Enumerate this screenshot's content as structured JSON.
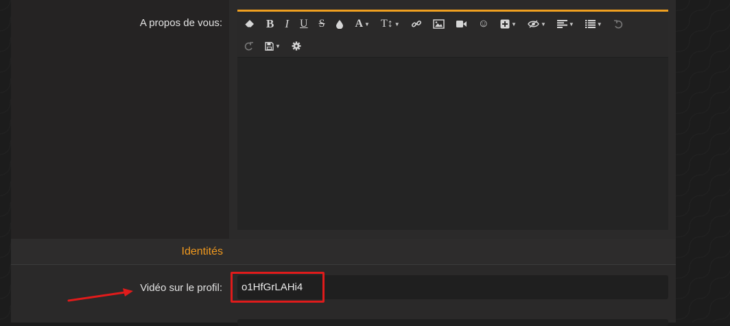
{
  "about": {
    "label": "A propos de vous:"
  },
  "toolbar": {
    "row1": [
      {
        "name": "eraser-icon",
        "label": ""
      },
      {
        "name": "bold-button",
        "label": "B"
      },
      {
        "name": "italic-button",
        "label": "I"
      },
      {
        "name": "underline-button",
        "label": "U"
      },
      {
        "name": "strikethrough-button",
        "label": "S"
      },
      {
        "name": "color-drop-icon",
        "label": ""
      },
      {
        "name": "font-family-button",
        "label": "A"
      },
      {
        "name": "font-size-button",
        "label": "T↕"
      },
      {
        "name": "link-icon",
        "label": ""
      },
      {
        "name": "image-icon",
        "label": ""
      },
      {
        "name": "video-icon",
        "label": ""
      },
      {
        "name": "smiley-icon",
        "label": "☺"
      },
      {
        "name": "insert-icon",
        "label": ""
      },
      {
        "name": "spoiler-icon",
        "label": ""
      },
      {
        "name": "align-icon",
        "label": ""
      },
      {
        "name": "list-icon",
        "label": ""
      },
      {
        "name": "undo-icon",
        "label": ""
      }
    ],
    "row2": [
      {
        "name": "redo-icon",
        "label": ""
      },
      {
        "name": "save-draft-icon",
        "label": ""
      },
      {
        "name": "settings-gear-icon",
        "label": ""
      }
    ]
  },
  "section": {
    "title": "Identités"
  },
  "video": {
    "label": "Vidéo sur le profil:",
    "value": "o1HfGrLAHi4"
  },
  "colors": {
    "accent": "#f0a020",
    "section_title": "#f29a1e",
    "annotation_red": "#e01b1b"
  }
}
